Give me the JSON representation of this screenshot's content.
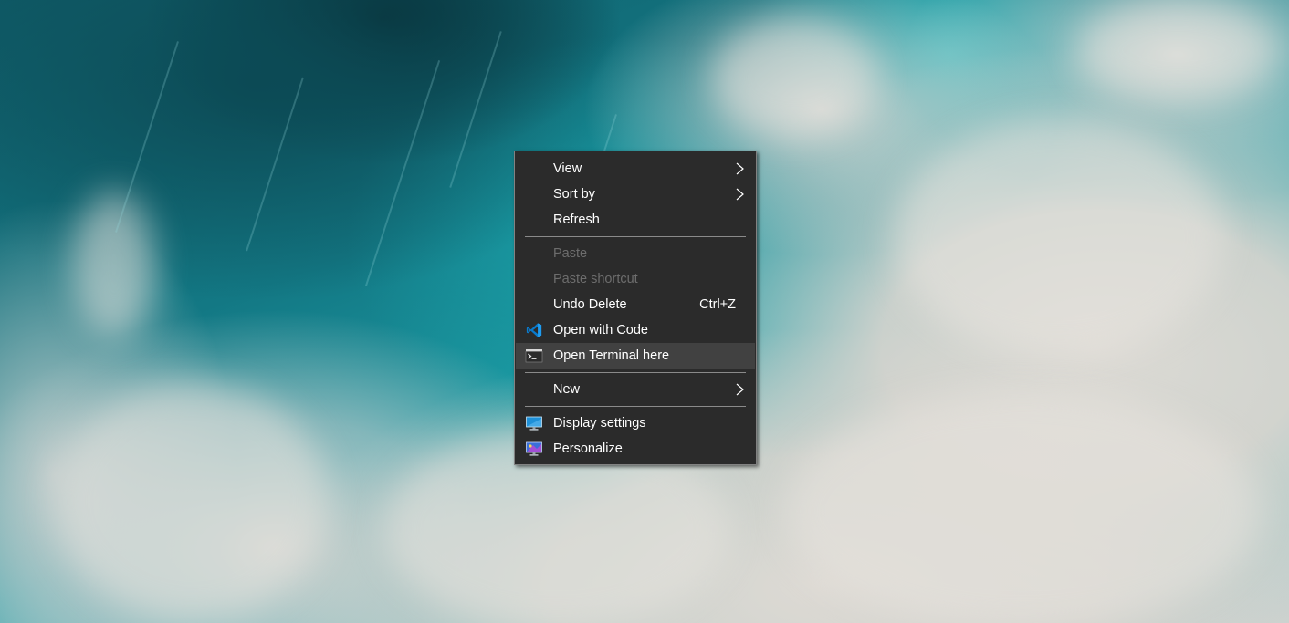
{
  "desktop": {
    "wallpaper": "ocean-waves-aerial"
  },
  "context_menu": {
    "items": [
      {
        "label": "View",
        "submenu": true,
        "enabled": true
      },
      {
        "label": "Sort by",
        "submenu": true,
        "enabled": true
      },
      {
        "label": "Refresh",
        "enabled": true
      },
      {
        "label": "Paste",
        "enabled": false
      },
      {
        "label": "Paste shortcut",
        "enabled": false
      },
      {
        "label": "Undo Delete",
        "shortcut": "Ctrl+Z",
        "enabled": true
      },
      {
        "label": "Open with Code",
        "icon": "vscode-icon",
        "enabled": true
      },
      {
        "label": "Open Terminal here",
        "icon": "terminal-icon",
        "enabled": true,
        "highlighted": true
      },
      {
        "label": "New",
        "submenu": true,
        "enabled": true
      },
      {
        "label": "Display settings",
        "icon": "display-settings-icon",
        "enabled": true
      },
      {
        "label": "Personalize",
        "icon": "personalize-icon",
        "enabled": true
      }
    ]
  },
  "colors": {
    "menu_background": "#2b2b2b",
    "menu_text": "#ffffff",
    "menu_text_disabled": "#6d6d6d",
    "menu_highlight": "#414141",
    "menu_border": "#828282",
    "vscode_blue": "#0a7acc"
  }
}
